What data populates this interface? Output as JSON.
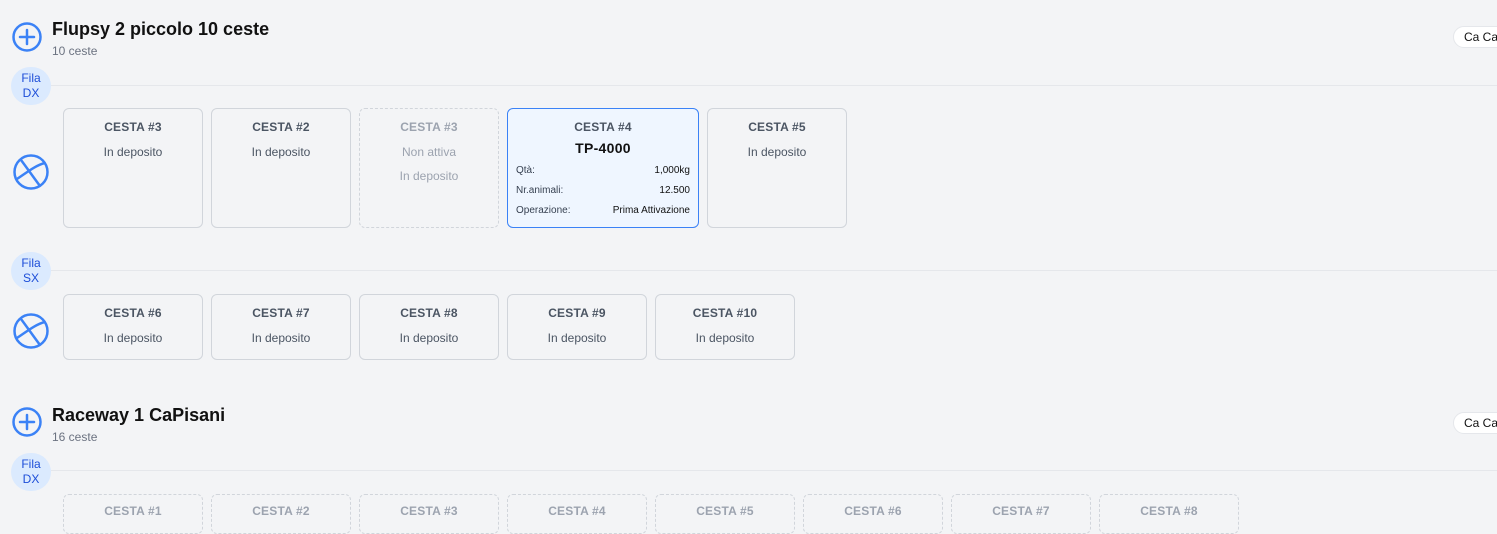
{
  "colors": {
    "accent": "#3b82f6",
    "label_bg": "#dbeafe",
    "label_text": "#1d4ed8",
    "active_bg": "#eff6ff"
  },
  "flupsy1": {
    "title": "Flupsy 2 piccolo 10 ceste",
    "subtitle": "10 ceste",
    "badge": "Ca Ca",
    "row_dx": {
      "label_line1": "Fila",
      "label_line2": "DX"
    },
    "row_sx": {
      "label_line1": "Fila",
      "label_line2": "SX"
    },
    "dx_baskets": [
      {
        "title": "CESTA #3",
        "status": "In deposito"
      },
      {
        "title": "CESTA #2",
        "status": "In deposito"
      },
      {
        "title": "CESTA #3",
        "status": "Non attiva",
        "status2": "In deposito"
      },
      {
        "title": "CESTA #4",
        "code": "TP-4000",
        "qty_label": "Qtà:",
        "qty": "1,000kg",
        "animals_label": "Nr.animali:",
        "animals": "12.500",
        "op_label": "Operazione:",
        "op": "Prima Attivazione"
      },
      {
        "title": "CESTA #5",
        "status": "In deposito"
      }
    ],
    "sx_baskets": [
      {
        "title": "CESTA #6",
        "status": "In deposito"
      },
      {
        "title": "CESTA #7",
        "status": "In deposito"
      },
      {
        "title": "CESTA #8",
        "status": "In deposito"
      },
      {
        "title": "CESTA #9",
        "status": "In deposito"
      },
      {
        "title": "CESTA #10",
        "status": "In deposito"
      }
    ]
  },
  "flupsy2": {
    "title": "Raceway 1 CaPisani",
    "subtitle": "16 ceste",
    "badge": "Ca Ca",
    "row_dx": {
      "label_line1": "Fila",
      "label_line2": "DX"
    },
    "dx_baskets": [
      {
        "title": "CESTA #1"
      },
      {
        "title": "CESTA #2"
      },
      {
        "title": "CESTA #3"
      },
      {
        "title": "CESTA #4"
      },
      {
        "title": "CESTA #5"
      },
      {
        "title": "CESTA #6"
      },
      {
        "title": "CESTA #7"
      },
      {
        "title": "CESTA #8"
      }
    ]
  }
}
